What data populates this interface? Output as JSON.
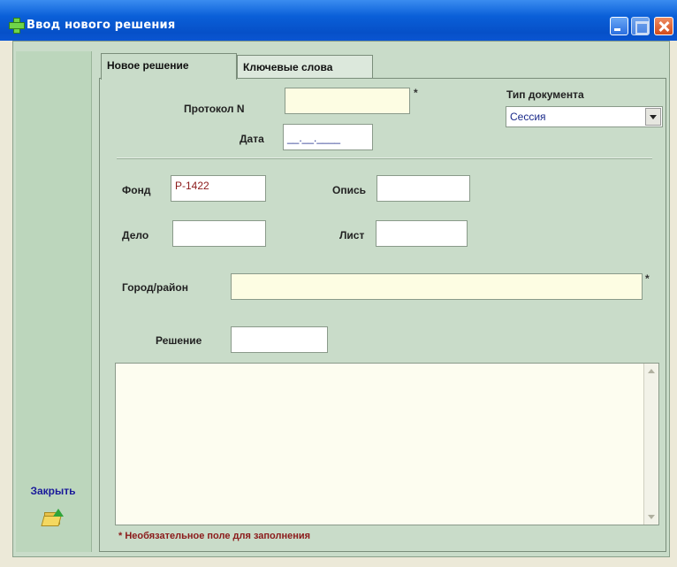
{
  "window": {
    "title": "Ввод нового решения"
  },
  "sidebar": {
    "close_label": "Закрыть"
  },
  "tabs": [
    {
      "label": "Новое решение",
      "active": true
    },
    {
      "label": "Ключевые слова",
      "active": false
    }
  ],
  "form": {
    "protocol": {
      "label": "Протокол N",
      "value": "",
      "required_mark": "*"
    },
    "date": {
      "label": "Дата",
      "value": "__.__.____"
    },
    "doc_type": {
      "label": "Тип документа",
      "value": "Сессия"
    },
    "fond": {
      "label": "Фонд",
      "value": "Р-1422"
    },
    "opis": {
      "label": "Опись",
      "value": ""
    },
    "delo": {
      "label": "Дело",
      "value": ""
    },
    "list": {
      "label": "Лист",
      "value": ""
    },
    "city": {
      "label": "Город/район",
      "value": "",
      "required_mark": "*"
    },
    "decision": {
      "label": "Решение",
      "value": ""
    },
    "decision_text": {
      "value": ""
    }
  },
  "footer": {
    "note": "* Необязательное поле для заполнения"
  },
  "colors": {
    "titlebar": "#0a5fd8",
    "panel": "#c9dcc9",
    "sidebar": "#bcd6bc",
    "note": "#8b1a1a",
    "link": "#1a1a9a"
  }
}
